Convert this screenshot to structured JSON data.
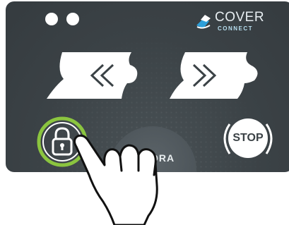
{
  "brand": {
    "line1": "COVER",
    "line2": "CONNECT",
    "logo_icon": "cover-connect-logo-icon"
  },
  "controls": {
    "open_button_icon": "double-chevron-left-icon",
    "close_button_icon": "double-chevron-right-icon",
    "lock_button_icon": "padlock-icon",
    "stop_label": "STOP",
    "knob_label": "ORA"
  },
  "indicators": {
    "count": 2
  },
  "colors": {
    "panel": "#3b4246",
    "accent_green": "#8bc53f",
    "icon_white": "#ffffff",
    "logo_blue": "#2d9fd9"
  }
}
